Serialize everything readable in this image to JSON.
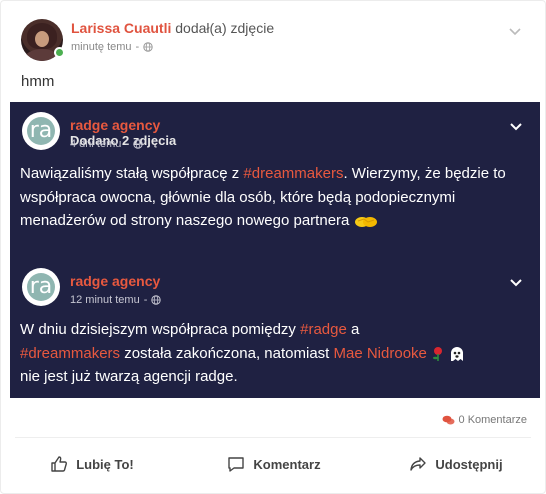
{
  "post": {
    "author": "Larissa Cuautli",
    "action": "dodał(a) zdjęcie",
    "time": "minutę temu",
    "text": "hmm"
  },
  "shared_post": {
    "author": "radge agency",
    "action": "Dodano 2 zdjęcia",
    "time": "4 dni temu",
    "text_before": "Nawiązaliśmy stałą współpracę z ",
    "hashtag": "#dreammakers",
    "text_after": ". Wierzymy, że będzie to współpraca owocna, głównie dla osób, które będą podopiecznymi menadżerów od strony naszego nowego partnera"
  },
  "nested_post": {
    "author": "radge agency",
    "time": "12 minut temu",
    "text_1": "W dniu dzisiejszym współpraca pomiędzy ",
    "hashtag_1": "#radge",
    "text_2": " a ",
    "hashtag_2": "#dreammakers",
    "text_3": " została zakończona, natomiast ",
    "mention": "Mae Nidrooke",
    "text_4": " nie jest już twarzą agencji radge."
  },
  "logo_letter": "ra",
  "comments": {
    "count_label": "0 Komentarze"
  },
  "actions": {
    "like": "Lubię To!",
    "comment": "Komentarz",
    "share": "Udostępnij"
  },
  "colors": {
    "accent": "#e0533f",
    "shared_bg": "#1f2142",
    "online": "#4caf50"
  }
}
